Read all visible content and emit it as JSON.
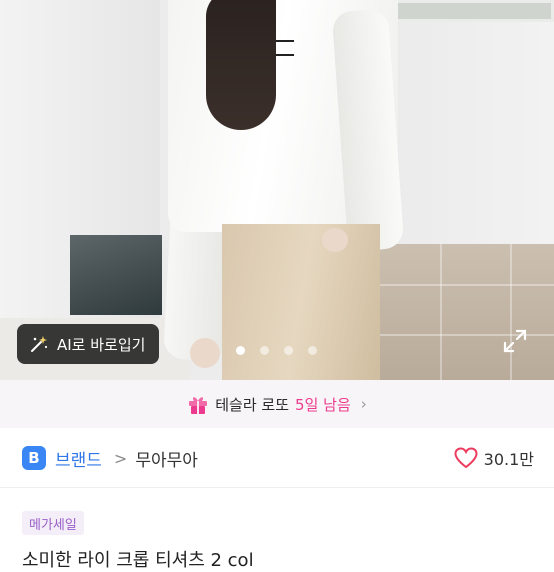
{
  "gallery": {
    "ai_button_label": "AI로 바로입기",
    "slide_count": 4,
    "active_slide": 1
  },
  "banner": {
    "prefix": "테슬라 로또",
    "highlight": "5일 남음",
    "accent_color": "#ec3b8e"
  },
  "brand": {
    "badge": "B",
    "label": "브랜드",
    "separator": ">",
    "name": "무아무아",
    "accent_color": "#2f77e8"
  },
  "likes": {
    "count": "30.1만"
  },
  "product": {
    "tag": "메가세일",
    "title_partial": "소미한 라이 크롭 티셔츠 2 col"
  }
}
